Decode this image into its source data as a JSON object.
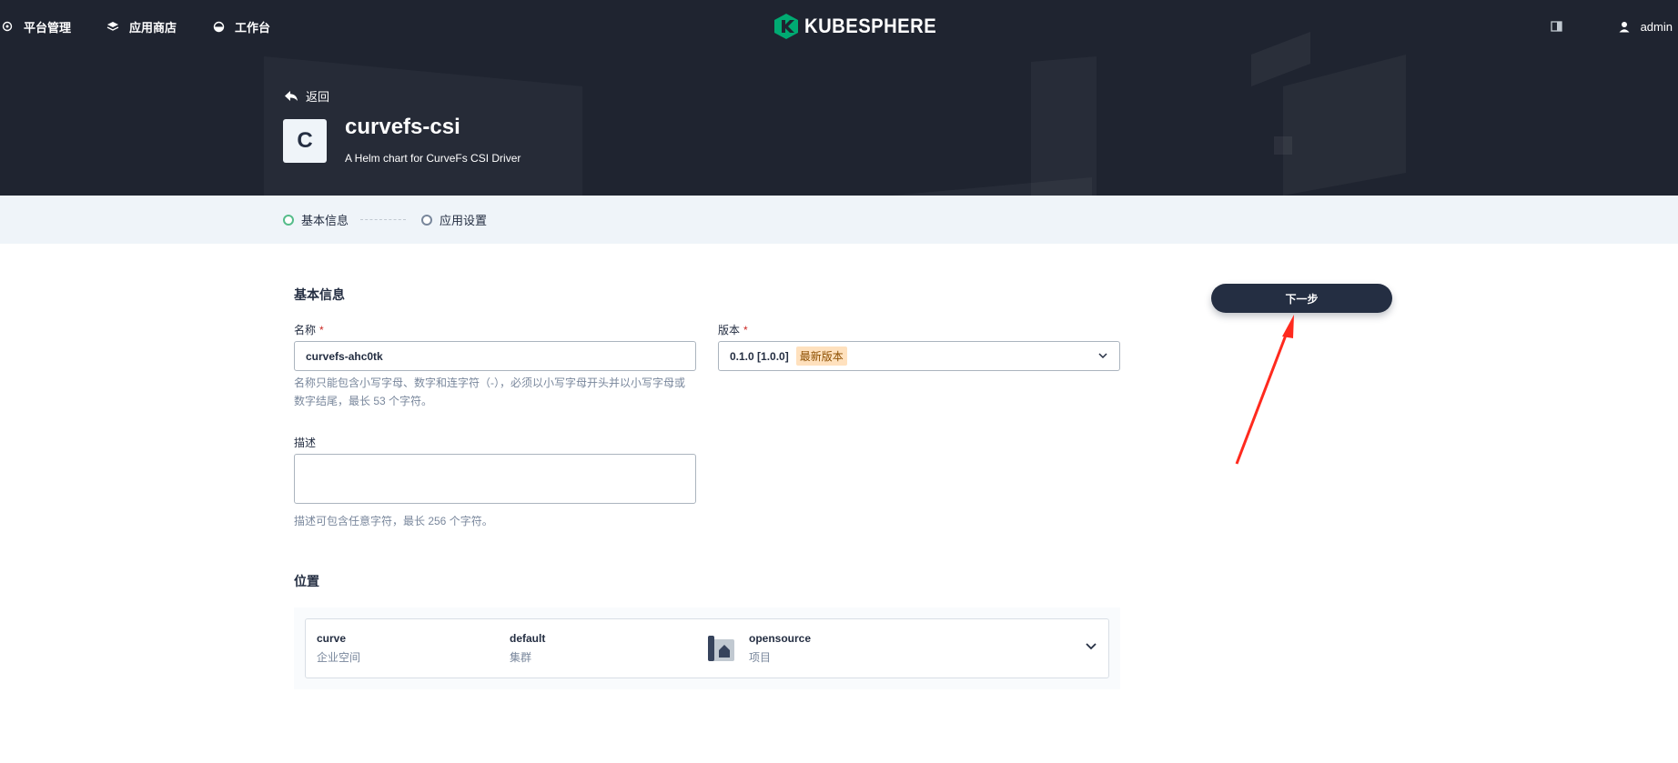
{
  "nav": {
    "items": [
      {
        "label": "平台管理",
        "icon": "cluster-icon"
      },
      {
        "label": "应用商店",
        "icon": "appstore-icon"
      },
      {
        "label": "工作台",
        "icon": "workbench-icon"
      }
    ]
  },
  "brand": {
    "name": "KUBESPHERE",
    "accent": "#00aa72"
  },
  "user": {
    "name": "admin"
  },
  "header": {
    "back_label": "返回",
    "avatar_letter": "C",
    "app_name": "curvefs-csi",
    "app_description": "A Helm chart for CurveFs CSI Driver"
  },
  "steps": [
    {
      "label": "基本信息",
      "active": true
    },
    {
      "label": "应用设置",
      "active": false
    }
  ],
  "form": {
    "section_basic": "基本信息",
    "name_label": "名称",
    "required_mark": "*",
    "name_value": "curvefs-ahc0tk",
    "name_hint_line1": "名称只能包含小写字母、数字和连字符（-），必须以小写字母开头并以小写字母或",
    "name_hint_line2": "数字结尾，最长 53 个字符。",
    "version_label": "版本",
    "version_value": "0.1.0 [1.0.0]",
    "version_badge": "最新版本",
    "desc_label": "描述",
    "desc_value": "",
    "desc_hint": "描述可包含任意字符，最长 256 个字符。",
    "section_location": "位置"
  },
  "location": {
    "workspace": {
      "value": "curve",
      "label": "企业空间"
    },
    "cluster": {
      "value": "default",
      "label": "集群"
    },
    "project": {
      "value": "opensource",
      "label": "项目"
    }
  },
  "actions": {
    "next_label": "下一步"
  },
  "colors": {
    "header_bg": "#1f2430",
    "steps_bg": "#eff4f9",
    "annotation_arrow": "#ff2a1e"
  }
}
